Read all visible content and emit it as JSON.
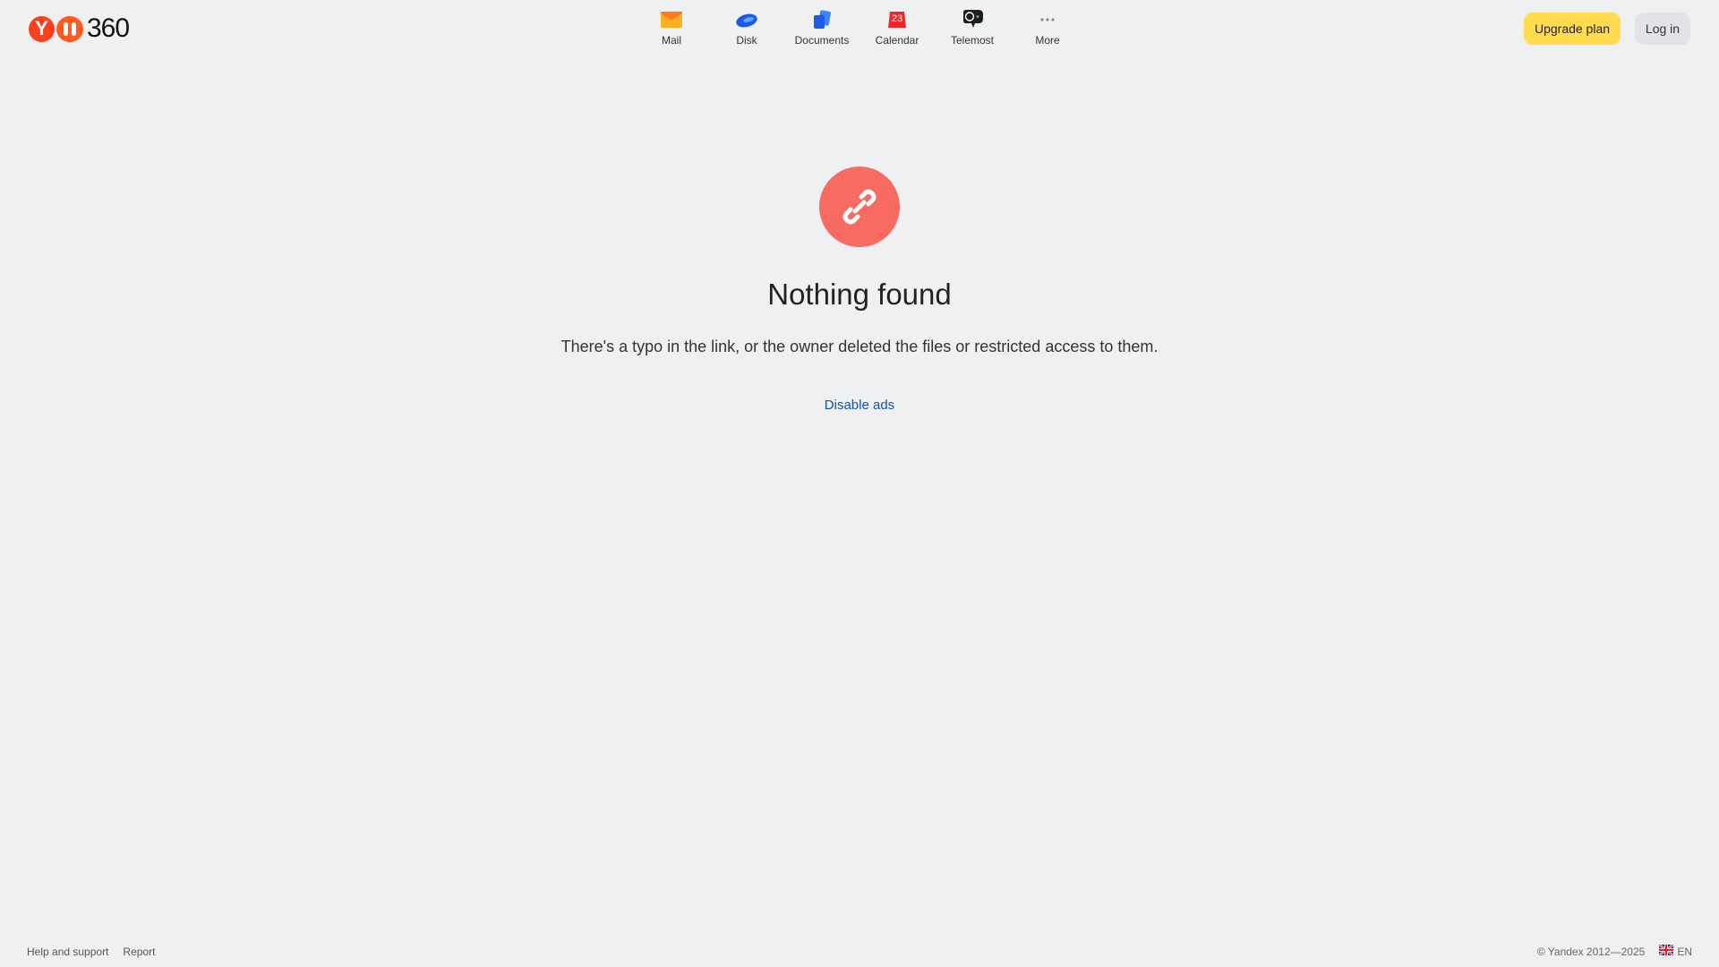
{
  "header": {
    "logo_text": "360",
    "nav": [
      {
        "label": "Mail",
        "icon": "mail-icon"
      },
      {
        "label": "Disk",
        "icon": "disk-icon"
      },
      {
        "label": "Documents",
        "icon": "documents-icon"
      },
      {
        "label": "Calendar",
        "icon": "calendar-icon",
        "badge": "23"
      },
      {
        "label": "Telemost",
        "icon": "telemost-icon"
      },
      {
        "label": "More",
        "icon": "more-icon"
      }
    ],
    "upgrade_label": "Upgrade plan",
    "login_label": "Log in"
  },
  "main": {
    "icon": "broken-link-icon",
    "title": "Nothing found",
    "subtitle": "There's a typo in the link, or the owner deleted the files or restricted access to them.",
    "link_label": "Disable ads"
  },
  "footer": {
    "help_label": "Help and support",
    "report_label": "Report",
    "copyright": "© Yandex 2012—2025",
    "language": "EN"
  },
  "colors": {
    "background": "#eff0f2",
    "accent_yellow": "#ffdb4d",
    "error_red": "#f76b63",
    "link_blue": "#1553a8",
    "brand_red": "#fc3f1d"
  }
}
